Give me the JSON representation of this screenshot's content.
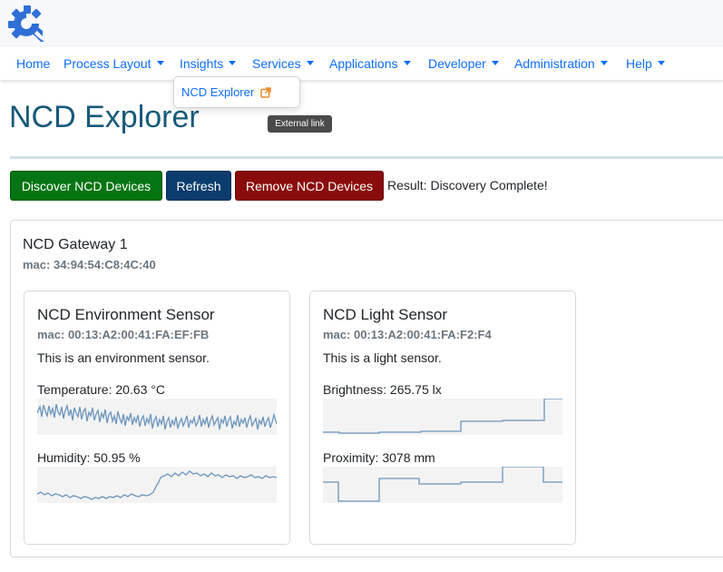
{
  "nav": {
    "items": [
      "Home",
      "Process Layout",
      "Insights",
      "Services",
      "Applications",
      "Developer",
      "Administration",
      "Help"
    ],
    "dropdown_item": "NCD Explorer",
    "tooltip": "External link"
  },
  "page": {
    "title": "NCD Explorer"
  },
  "actions": {
    "discover_label": "Discover NCD Devices",
    "refresh_label": "Refresh",
    "remove_label": "Remove NCD Devices",
    "result_text": "Result: Discovery Complete!"
  },
  "gateway": {
    "name": "NCD Gateway 1",
    "mac": "mac: 34:94:54:C8:4C:40"
  },
  "sensors": [
    {
      "name": "NCD Environment Sensor",
      "mac": "mac: 00:13:A2:00:41:FA:EF:FB",
      "description": "This is an environment sensor.",
      "readings": [
        {
          "label": "Temperature: 20.63 °C",
          "spark": "noisy"
        },
        {
          "label": "Humidity: 50.95 %",
          "spark": "rising"
        }
      ]
    },
    {
      "name": "NCD Light Sensor",
      "mac": "mac: 00:13:A2:00:41:FA:F2:F4",
      "description": "This is a light sensor.",
      "readings": [
        {
          "label": "Brightness: 265.75 lx",
          "spark": "step-up"
        },
        {
          "label": "Proximity: 3078 mm",
          "spark": "step-mixed"
        }
      ]
    }
  ],
  "colors": {
    "link": "#0d6efd",
    "title": "#175a7a",
    "discover": "#047512",
    "refresh": "#0a3c6e",
    "remove": "#8a0b0b",
    "spark_line": "#6c95bd"
  },
  "icons": [
    "gear-logo-icon",
    "external-link-icon",
    "caret-down-icon"
  ]
}
